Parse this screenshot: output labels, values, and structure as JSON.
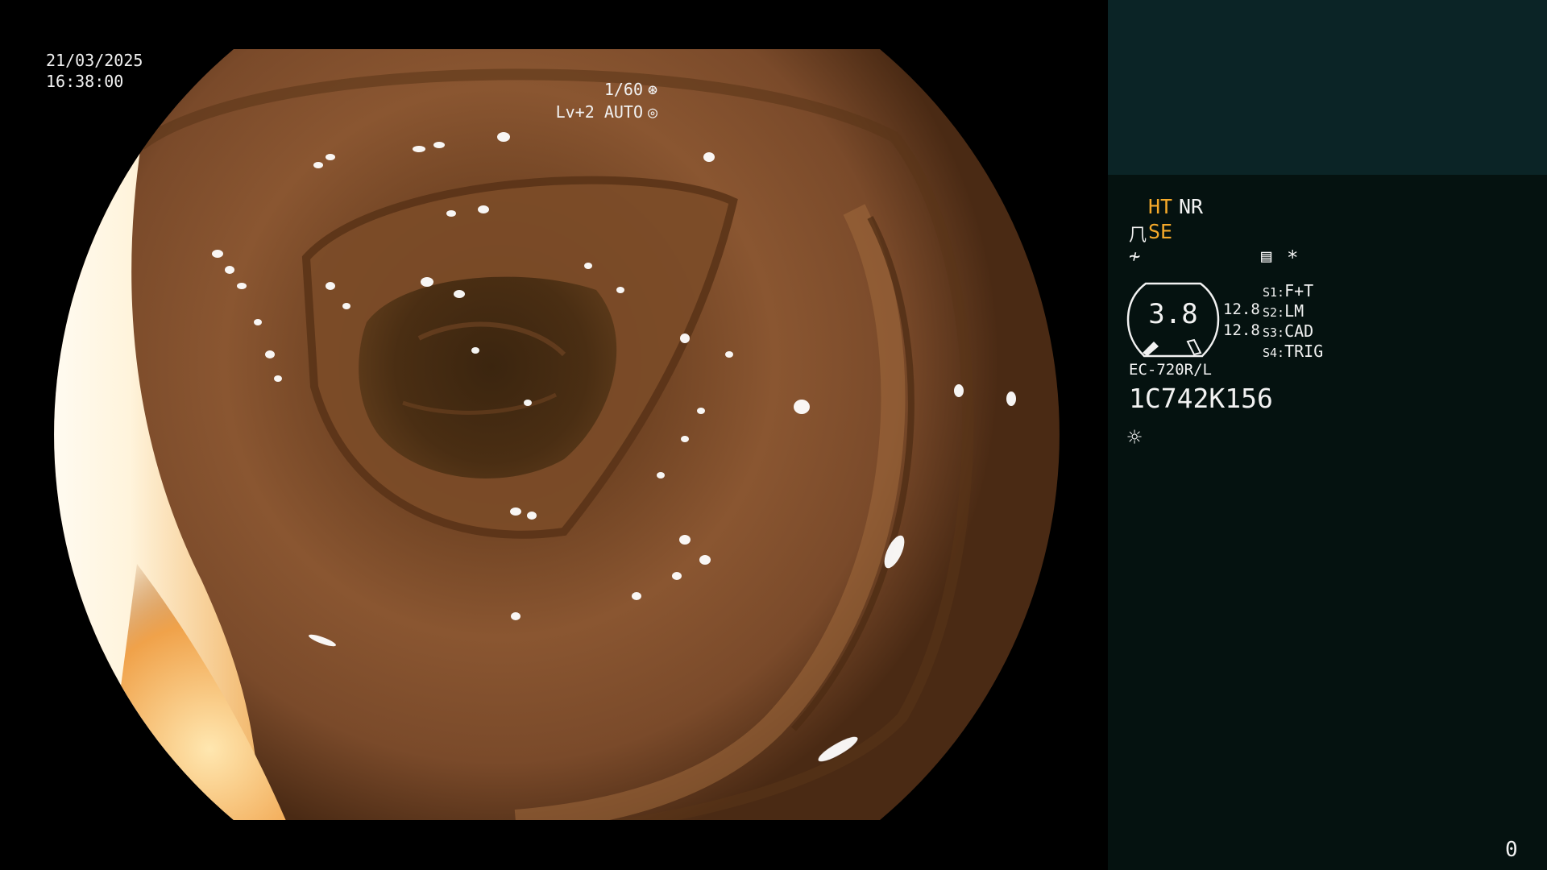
{
  "overlay": {
    "date": "21/03/2025",
    "time": "16:38:00",
    "shutter": "1/60",
    "shutter_icon": "shutter-icon",
    "shutter_glyph": "⊛",
    "level": "Lv+2 AUTO",
    "iris_icon": "iris-auto-icon",
    "iris_glyph": "◎"
  },
  "panel": {
    "ht": "HT",
    "nr": "NR",
    "se_icon": "scope-tip-icon",
    "se_glyph": "⺇",
    "se": "SE",
    "freeze_icon": "freeze-icon",
    "freeze_glyph": "≁",
    "memo_icon": "memo-icon",
    "memo_glyph": "▤",
    "star_glyph": "*",
    "gauge_value": "3.8",
    "scale_1": "12.8",
    "scale_2": "12.8",
    "switches": [
      {
        "key": "S1:",
        "value": "F+T"
      },
      {
        "key": "S2:",
        "value": "LM"
      },
      {
        "key": "S3:",
        "value": "CAD"
      },
      {
        "key": "S4:",
        "value": "TRIG"
      }
    ],
    "scope_model": "EC-720R/L",
    "scope_serial": "1C742K156",
    "light_icon": "light-source-icon",
    "light_glyph": "☼",
    "frame_counter": "0"
  },
  "colors": {
    "panel_bg": "#051210",
    "panel_top_bg": "#0b2426",
    "accent_amber": "#f5a92a",
    "text": "#f2f2f2"
  }
}
